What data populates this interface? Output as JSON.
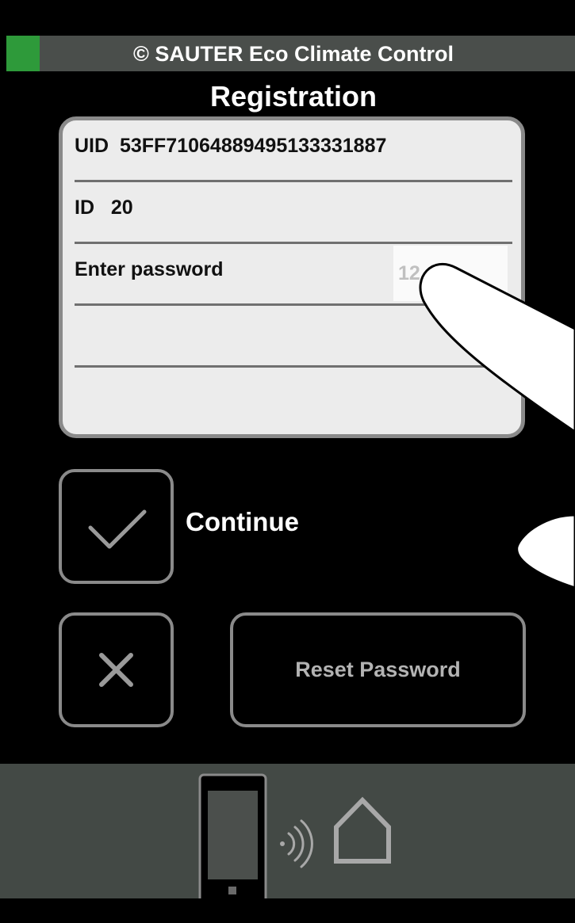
{
  "header": {
    "title": "© SAUTER Eco Climate Control",
    "status_color": "#2e9a3a"
  },
  "page": {
    "title": "Registration"
  },
  "card": {
    "uid_text": "UID  53FF71064889495133331887",
    "id_text": "ID   20",
    "password_label": "Enter password",
    "password_value": "12"
  },
  "actions": {
    "continue_label": "Continue",
    "reset_label": "Reset Password",
    "confirm_icon": "check-icon",
    "cancel_icon": "close-icon"
  },
  "footer": {
    "icons": [
      "smartphone-icon",
      "wireless-signal-icon",
      "home-icon"
    ]
  }
}
